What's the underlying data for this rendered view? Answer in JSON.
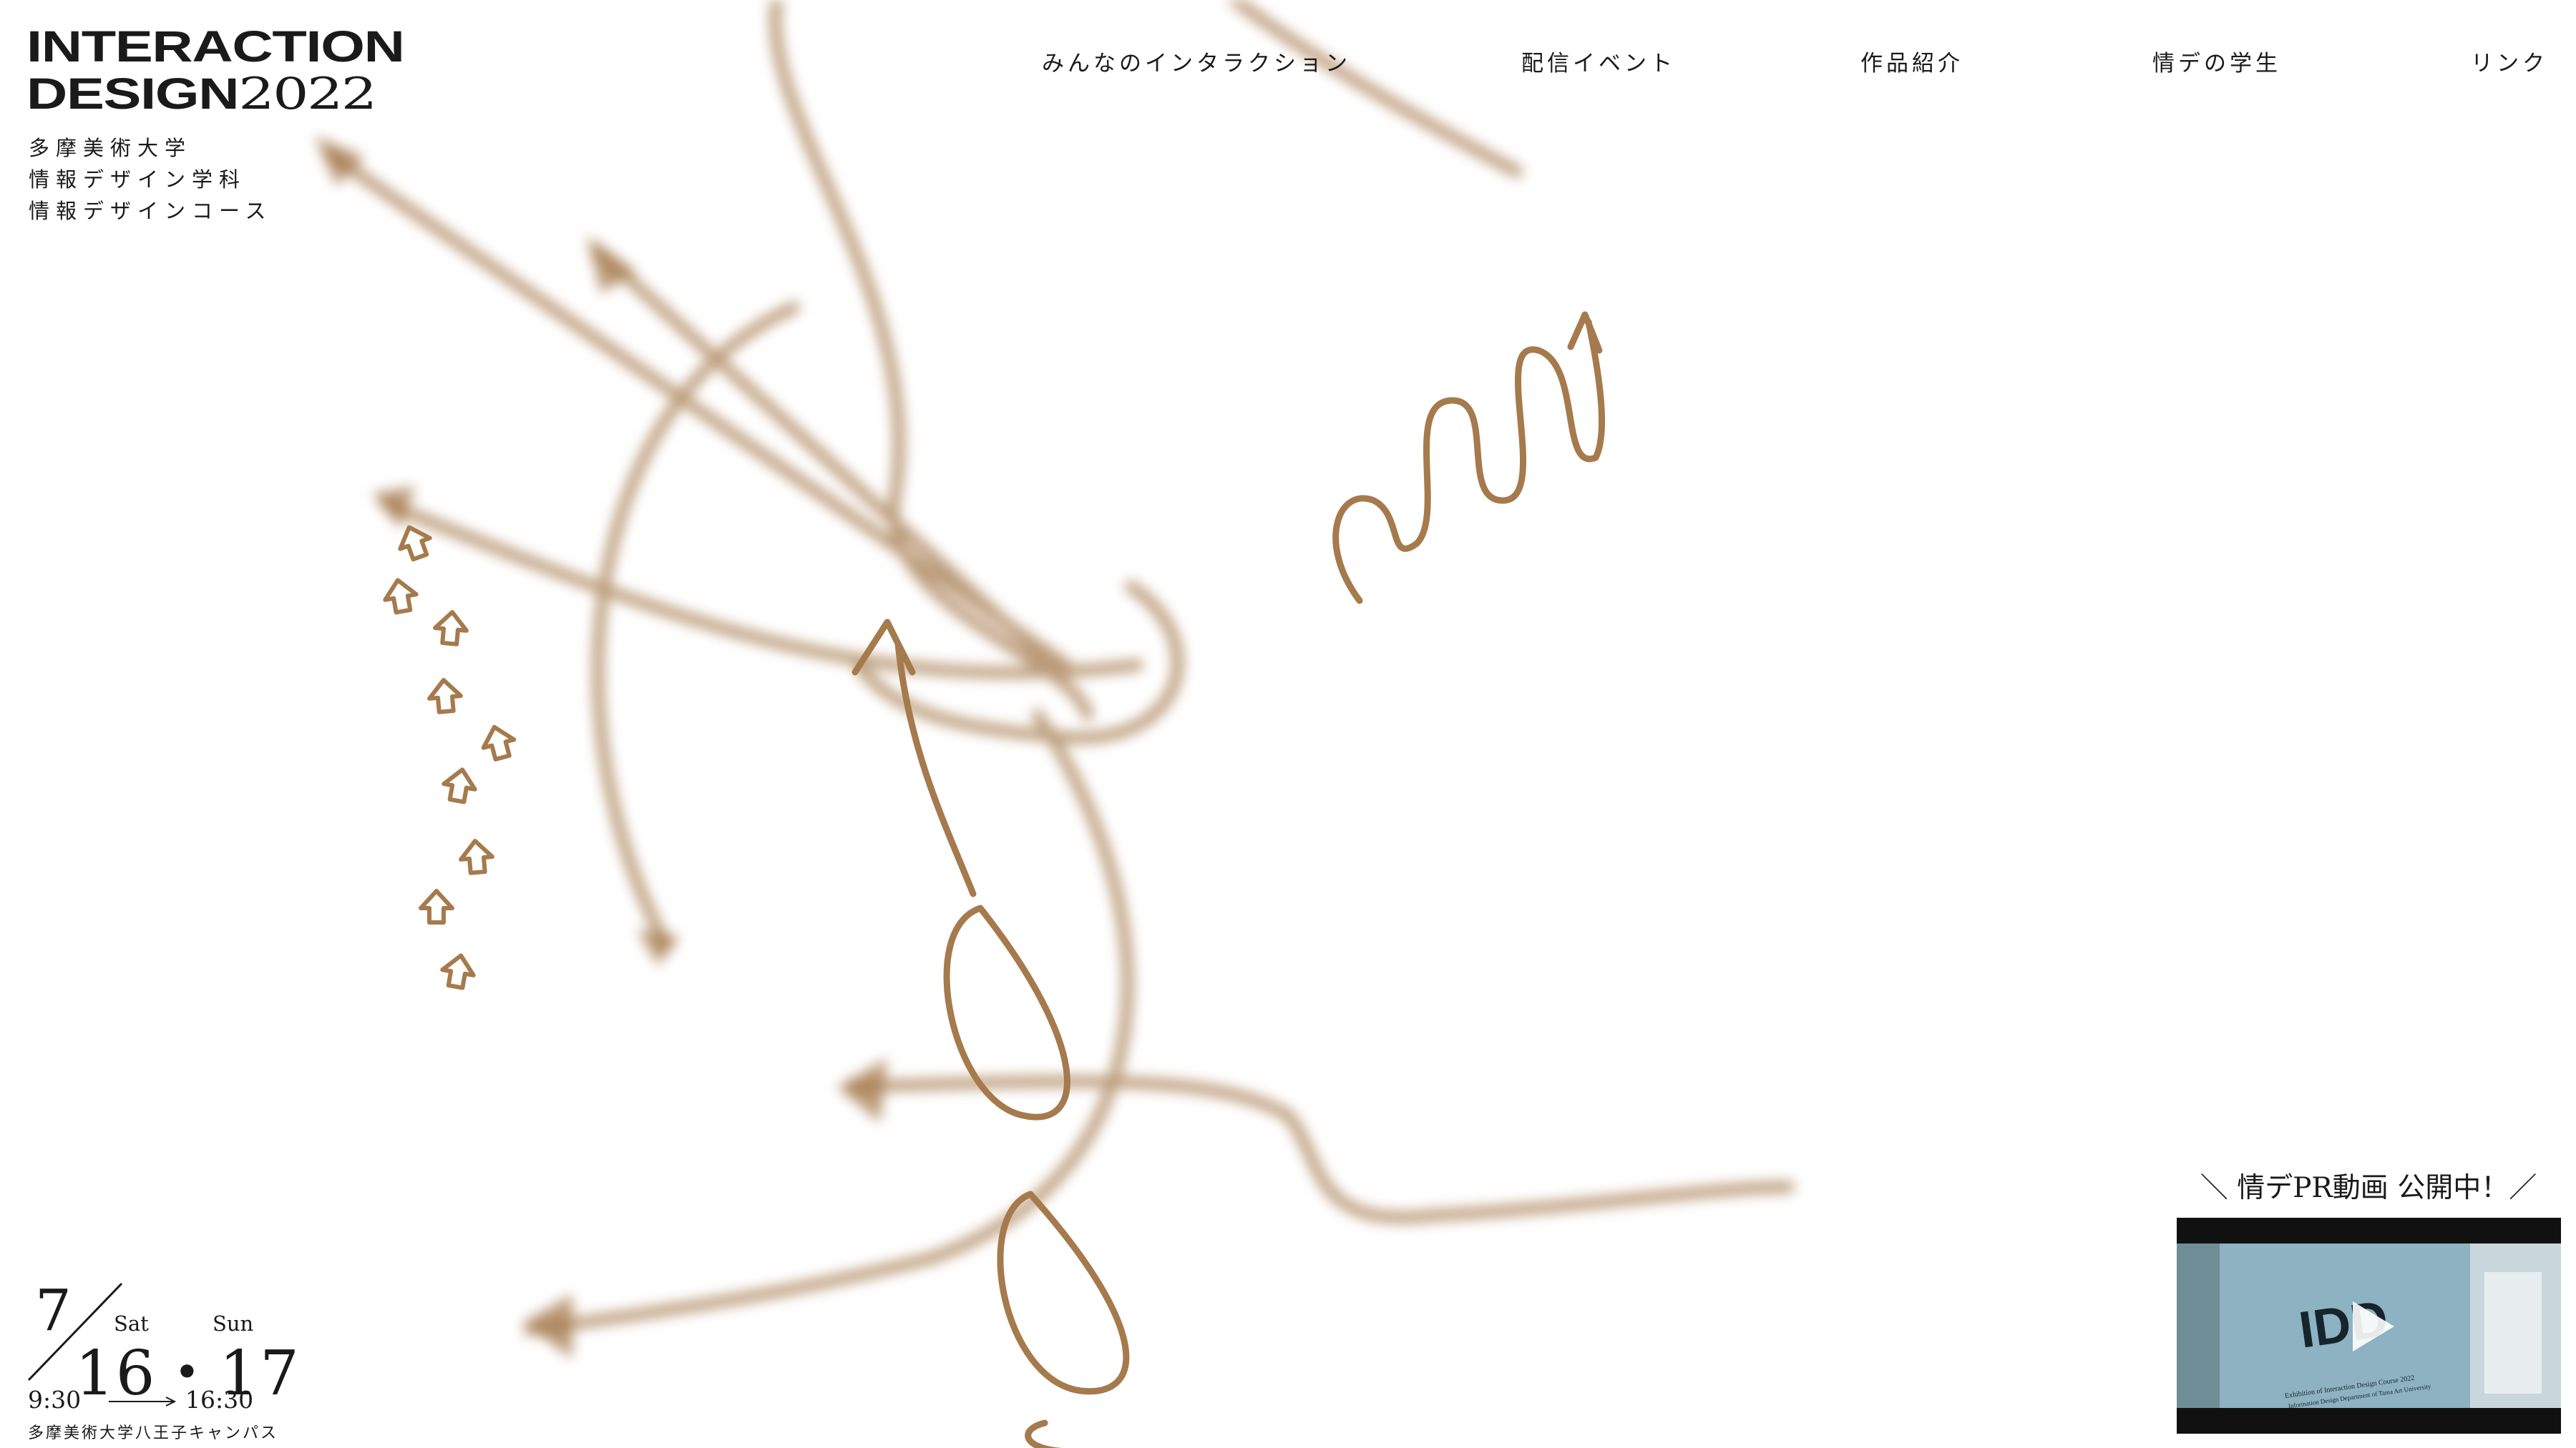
{
  "brand": {
    "logo_line1": "INTERACTION",
    "logo_line2_word": "DESIGN",
    "logo_line2_year": "2022",
    "dept_lines": [
      "多摩美術大学",
      "情報デザイン学科",
      "情報デザインコース"
    ]
  },
  "nav": {
    "items": [
      {
        "label": "みんなのインタラクション"
      },
      {
        "label": "配信イベント"
      },
      {
        "label": "作品紹介"
      },
      {
        "label": "情デの学生"
      },
      {
        "label": "リンク"
      }
    ]
  },
  "event": {
    "month": "7",
    "day1_weekday": "Sat",
    "day2_weekday": "Sun",
    "days": "16・17",
    "time_start": "9:30",
    "time_end": "16:30",
    "location": "多摩美術大学八王子キャンパス"
  },
  "pr": {
    "title": "＼ 情デPR動画 公開中！／",
    "video_sign_text": "IDD",
    "video_caption_line1": "Exhibition of Interaction Design Course 2022",
    "video_caption_line2": "Information Design Department of Tama Art University"
  },
  "colors": {
    "accent_brown": "#a57a4d",
    "text": "#1a1a1a",
    "background": "#ffffff"
  }
}
